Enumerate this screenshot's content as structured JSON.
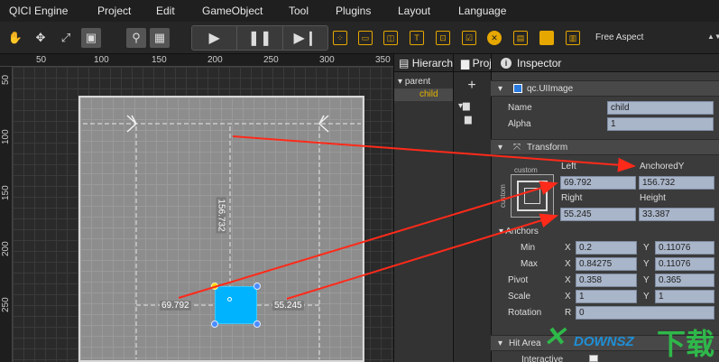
{
  "menu": {
    "items": [
      "QICI Engine",
      "Project",
      "Edit",
      "GameObject",
      "Tool",
      "Plugins",
      "Layout",
      "Language"
    ]
  },
  "toolbar": {
    "aspect": "Free Aspect"
  },
  "scene": {
    "ruler_top": [
      "50",
      "100",
      "150",
      "200",
      "250",
      "300",
      "350"
    ],
    "ruler_left": [
      "50",
      "100",
      "150",
      "200",
      "250"
    ],
    "dims": {
      "top": "156.732",
      "left": "69.792",
      "right": "55.245"
    }
  },
  "hierarchy": {
    "tab": "Hierarchy",
    "items": [
      "parent",
      "child"
    ]
  },
  "project": {
    "tab": "Project"
  },
  "inspector": {
    "tab": "Inspector",
    "component": "qc.UIImage",
    "name_label": "Name",
    "name_value": "child",
    "alpha_label": "Alpha",
    "alpha_value": "1",
    "transform_label": "Transform",
    "preset_label": "custom",
    "preset_side_label": "custom",
    "left_label": "Left",
    "anchoredy_label": "AnchoredY",
    "left_value": "69.792",
    "anchoredy_value": "156.732",
    "right_label": "Right",
    "height_label": "Height",
    "right_value": "55.245",
    "height_value": "33.387",
    "anchors_label": "Anchors",
    "min_label": "Min",
    "max_label": "Max",
    "pivot_label": "Pivot",
    "scale_label": "Scale",
    "rotation_label": "Rotation",
    "x_label": "X",
    "y_label": "Y",
    "r_label": "R",
    "min_x": "0.2",
    "min_y": "0.11076",
    "max_x": "0.84275",
    "max_y": "0.11076",
    "pivot_x": "0.358",
    "pivot_y": "0.365",
    "scale_x": "1",
    "scale_y": "1",
    "rotation_r": "0",
    "hitarea_label": "Hit Area",
    "interactive_label": "Interactive"
  },
  "watermark": {
    "text": "DOWNSZ",
    "cn": "下载"
  },
  "colors": {
    "accent_blue": "#00b3ff",
    "arrow_red": "#ff2a1a",
    "field_bg": "#a9b5c9"
  }
}
